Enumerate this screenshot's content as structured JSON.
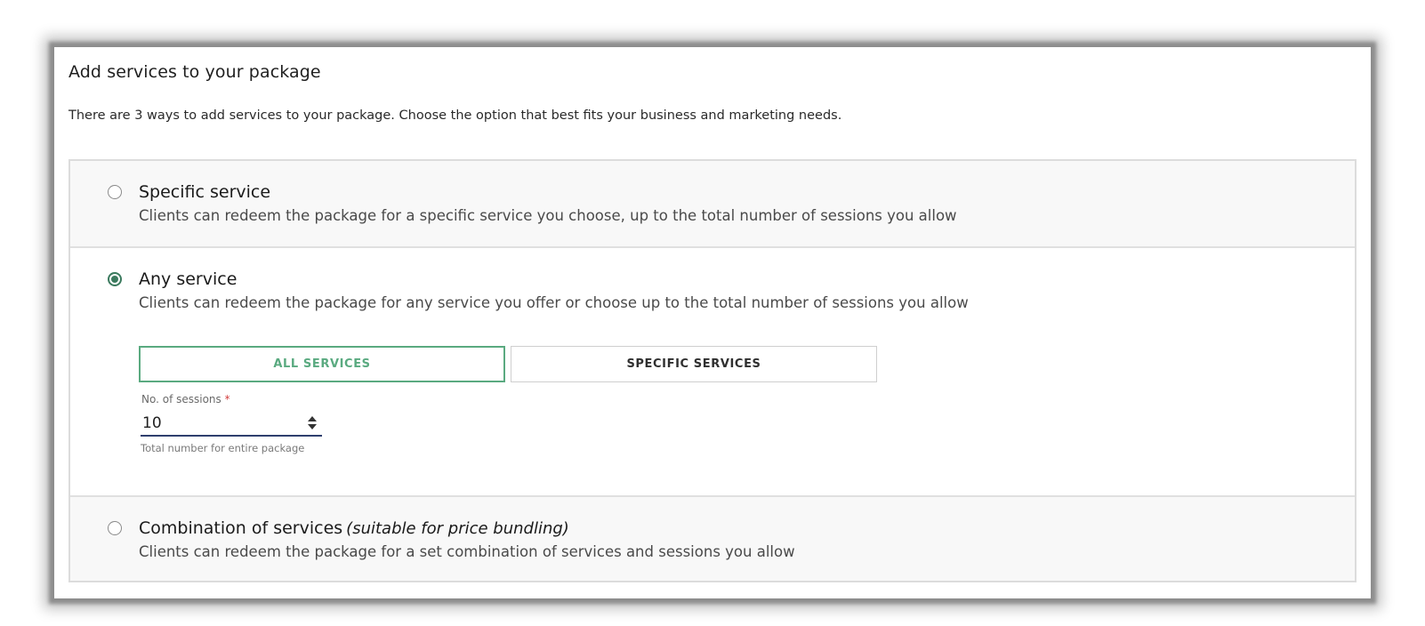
{
  "panel": {
    "title": "Add services to your package",
    "intro": "There are 3 ways to add services to your package. Choose the option that best fits your business and marketing needs."
  },
  "options": [
    {
      "title": "Specific service",
      "description": "Clients can redeem the package for a specific service you choose, up to the total number of sessions you allow",
      "selected": false
    },
    {
      "title": "Any service",
      "description": "Clients can redeem the package for any service you offer or choose up to the total number of sessions you allow",
      "selected": true
    },
    {
      "title": "Combination of services",
      "note": "(suitable for price bundling)",
      "description": "Clients can redeem the package for a set combination of services and sessions you allow",
      "selected": false
    }
  ],
  "service_scope": {
    "all_label": "ALL SERVICES",
    "specific_label": "SPECIFIC SERVICES",
    "active": "all"
  },
  "sessions": {
    "label": "No. of sessions",
    "required_mark": "*",
    "value": "10",
    "helper": "Total number for entire package"
  },
  "colors": {
    "accent_green": "#5aaa80",
    "radio_green": "#3b7a5e",
    "field_underline": "#2e3f6e",
    "required_red": "#d23c3c"
  }
}
